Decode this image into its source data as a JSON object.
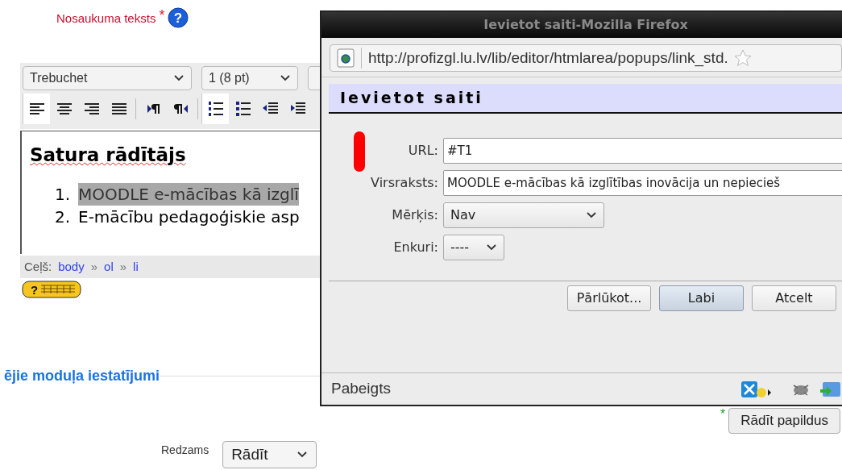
{
  "field_label": {
    "text": "Nosaukuma teksts",
    "required_mark": "*",
    "help_glyph": "?"
  },
  "keyboard_help_glyph": "?",
  "editor": {
    "font_select": "Trebuchet",
    "size_select": "1 (8 pt)",
    "tool_groups": [
      [
        {
          "kind": "align-left",
          "pressed": true
        },
        {
          "kind": "align-center",
          "pressed": false
        },
        {
          "kind": "align-right",
          "pressed": false
        },
        {
          "kind": "align-justify",
          "pressed": false
        }
      ],
      [
        {
          "kind": "ltr",
          "pressed": false
        },
        {
          "kind": "rtl",
          "pressed": false
        }
      ],
      [
        {
          "kind": "ordered-list",
          "pressed": true
        },
        {
          "kind": "unordered-list",
          "pressed": false
        },
        {
          "kind": "outdent",
          "pressed": false
        },
        {
          "kind": "indent",
          "pressed": false
        }
      ]
    ],
    "heading": "Satura rādītājs",
    "items": [
      {
        "number": "1.",
        "text": "MOODLE e-mācības kā izglī",
        "selected": true
      },
      {
        "number": "2.",
        "text": "E-mācību pedagoģiskie asp",
        "selected": false
      }
    ],
    "path_label": "Ceļš:",
    "path": [
      "body",
      "ol",
      "li"
    ],
    "path_separator": "»"
  },
  "section_heading": "ējie moduļa iestatījumi",
  "more_button": {
    "mark": "*",
    "label": "Rādīt papildus"
  },
  "visible_field": {
    "label": "Redzams",
    "value": "Rādīt"
  },
  "popup": {
    "title": "Ievietot saiti-Mozilla Firefox",
    "address": "http://profizgl.lu.lv/lib/editor/htmlarea/popups/link_std.",
    "heading": "Ievietot saiti",
    "fields": [
      {
        "kind": "text",
        "label": "URL:",
        "value": "#T1"
      },
      {
        "kind": "text",
        "label": "Virsraksts:",
        "value": "MOODLE e-mācības kā izglītības inovācija un nepiecieš"
      },
      {
        "kind": "select",
        "label": "Mērķis:",
        "value": "Nav"
      },
      {
        "kind": "select",
        "label": "Enkuri:",
        "value": "----"
      }
    ],
    "buttons": [
      {
        "label": "Pārlūkot...",
        "selected": false
      },
      {
        "label": "Labi",
        "selected": true
      },
      {
        "label": "Atcelt",
        "selected": false
      }
    ],
    "status": "Pabeigts"
  }
}
